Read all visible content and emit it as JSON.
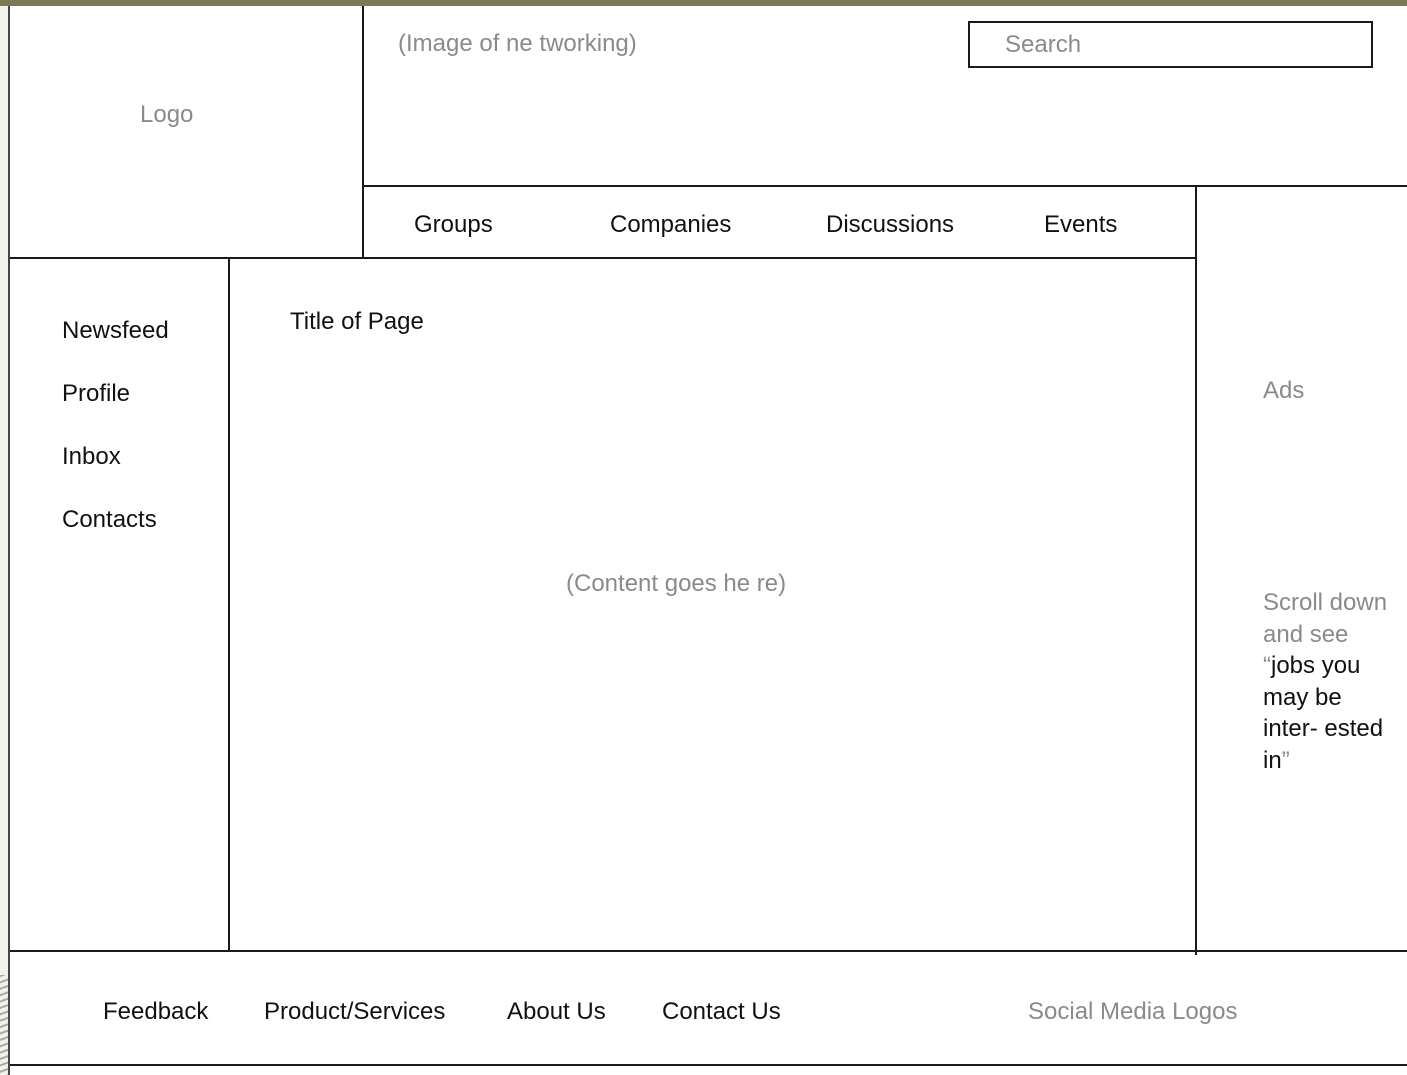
{
  "header": {
    "logo_label": "Logo",
    "banner_label": "(Image of ne tworking)",
    "search": {
      "placeholder": "Search",
      "value": ""
    }
  },
  "top_nav": {
    "items": [
      {
        "label": "Groups"
      },
      {
        "label": "Companies"
      },
      {
        "label": "Discussions"
      },
      {
        "label": "Events"
      }
    ]
  },
  "sidebar": {
    "items": [
      {
        "label": "Newsfeed"
      },
      {
        "label": "Profile"
      },
      {
        "label": "Inbox"
      },
      {
        "label": "Contacts"
      }
    ]
  },
  "main": {
    "page_title": "Title of Page",
    "content_placeholder": "(Content goes he re)"
  },
  "right_panel": {
    "ads_label": "Ads",
    "scroll_note_prefix": "Scroll down and see “",
    "scroll_note_highlight": "jobs you may be inter- ested in",
    "scroll_note_suffix": "”"
  },
  "footer": {
    "links": [
      {
        "label": "Feedback"
      },
      {
        "label": "Product/Services"
      },
      {
        "label": "About Us"
      },
      {
        "label": "Contact Us"
      }
    ],
    "social_label": "Social Media Logos"
  },
  "colors": {
    "frame_accent": "#7b7a57",
    "placeholder_text": "#8a8a8a",
    "line": "#1a1a1a"
  }
}
